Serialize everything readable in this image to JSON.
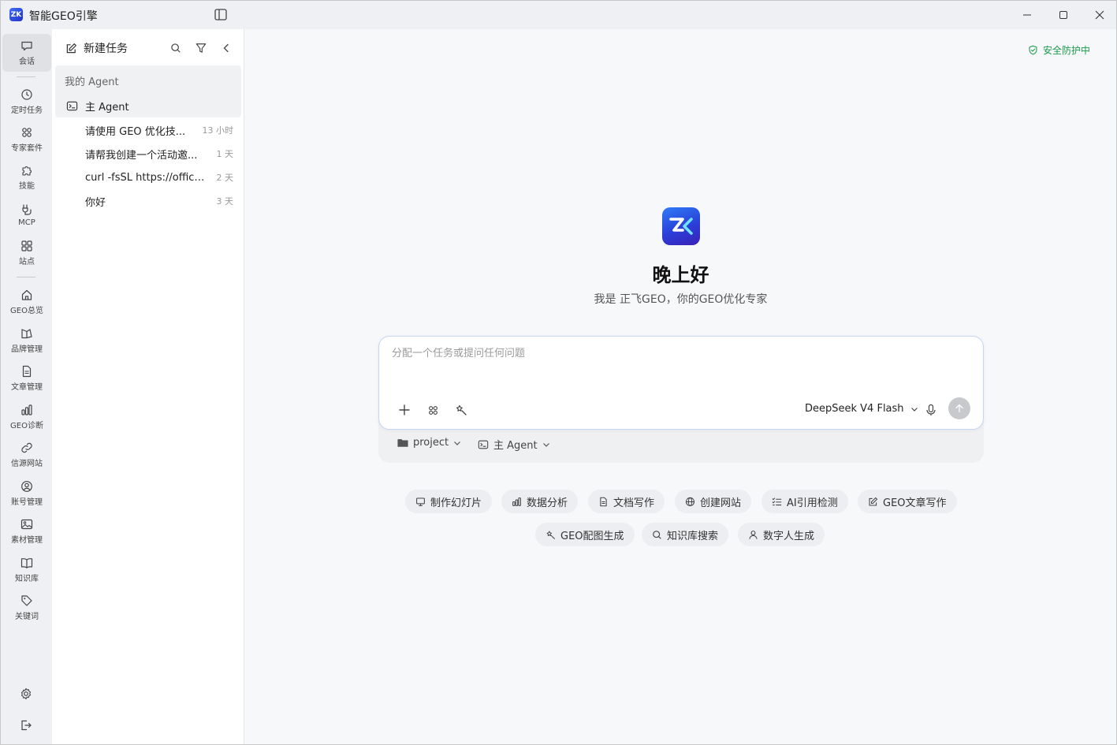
{
  "app": {
    "title": "智能GEO引擎",
    "logo_text": "ZK"
  },
  "rail": {
    "items": [
      {
        "label": "会话",
        "icon": "chat-icon"
      },
      {
        "label": "定时任务",
        "icon": "clock-icon"
      },
      {
        "label": "专家套件",
        "icon": "grid-icon"
      },
      {
        "label": "技能",
        "icon": "puzzle-icon"
      },
      {
        "label": "MCP",
        "icon": "plug-icon"
      },
      {
        "label": "站点",
        "icon": "sitemap-icon"
      },
      {
        "label": "GEO总览",
        "icon": "home-icon"
      },
      {
        "label": "品牌管理",
        "icon": "brand-icon"
      },
      {
        "label": "文章管理",
        "icon": "document-icon"
      },
      {
        "label": "GEO诊断",
        "icon": "bar-chart-icon"
      },
      {
        "label": "信源网站",
        "icon": "link-icon"
      },
      {
        "label": "账号管理",
        "icon": "user-circle-icon"
      },
      {
        "label": "素材管理",
        "icon": "image-icon"
      },
      {
        "label": "知识库",
        "icon": "book-icon"
      },
      {
        "label": "关键词",
        "icon": "tag-icon"
      }
    ]
  },
  "panel": {
    "new_task": "新建任务",
    "section_title": "我的 Agent",
    "agent_name": "主 Agent",
    "tasks": [
      {
        "title": "请使用 GEO 优化技...",
        "time": "13 小时"
      },
      {
        "title": "请帮我创建一个活动邀...",
        "time": "1 天"
      },
      {
        "title": "curl -fsSL https://officec...",
        "time": "2 天"
      },
      {
        "title": "你好",
        "time": "3 天"
      }
    ]
  },
  "main": {
    "security": "安全防护中",
    "greeting": "晚上好",
    "subtitle": "我是 正飞GEO，你的GEO优化专家",
    "input_placeholder": "分配一个任务或提问任何问题",
    "model": "DeepSeek V4 Flash",
    "context_folder": "project",
    "context_agent": "主 Agent",
    "quick_actions": [
      {
        "label": "制作幻灯片",
        "icon": "slides-icon"
      },
      {
        "label": "数据分析",
        "icon": "bar-chart-icon"
      },
      {
        "label": "文档写作",
        "icon": "document-icon"
      },
      {
        "label": "创建网站",
        "icon": "globe-icon"
      },
      {
        "label": "AI引用检测",
        "icon": "list-check-icon"
      },
      {
        "label": "GEO文章写作",
        "icon": "edit-icon"
      },
      {
        "label": "GEO配图生成",
        "icon": "magic-icon"
      },
      {
        "label": "知识库搜索",
        "icon": "search-icon"
      },
      {
        "label": "数字人生成",
        "icon": "person-icon"
      }
    ]
  },
  "colors": {
    "accent": "#2f5bea",
    "security": "#1a9a4a",
    "send_disabled": "#c7c9cd"
  }
}
